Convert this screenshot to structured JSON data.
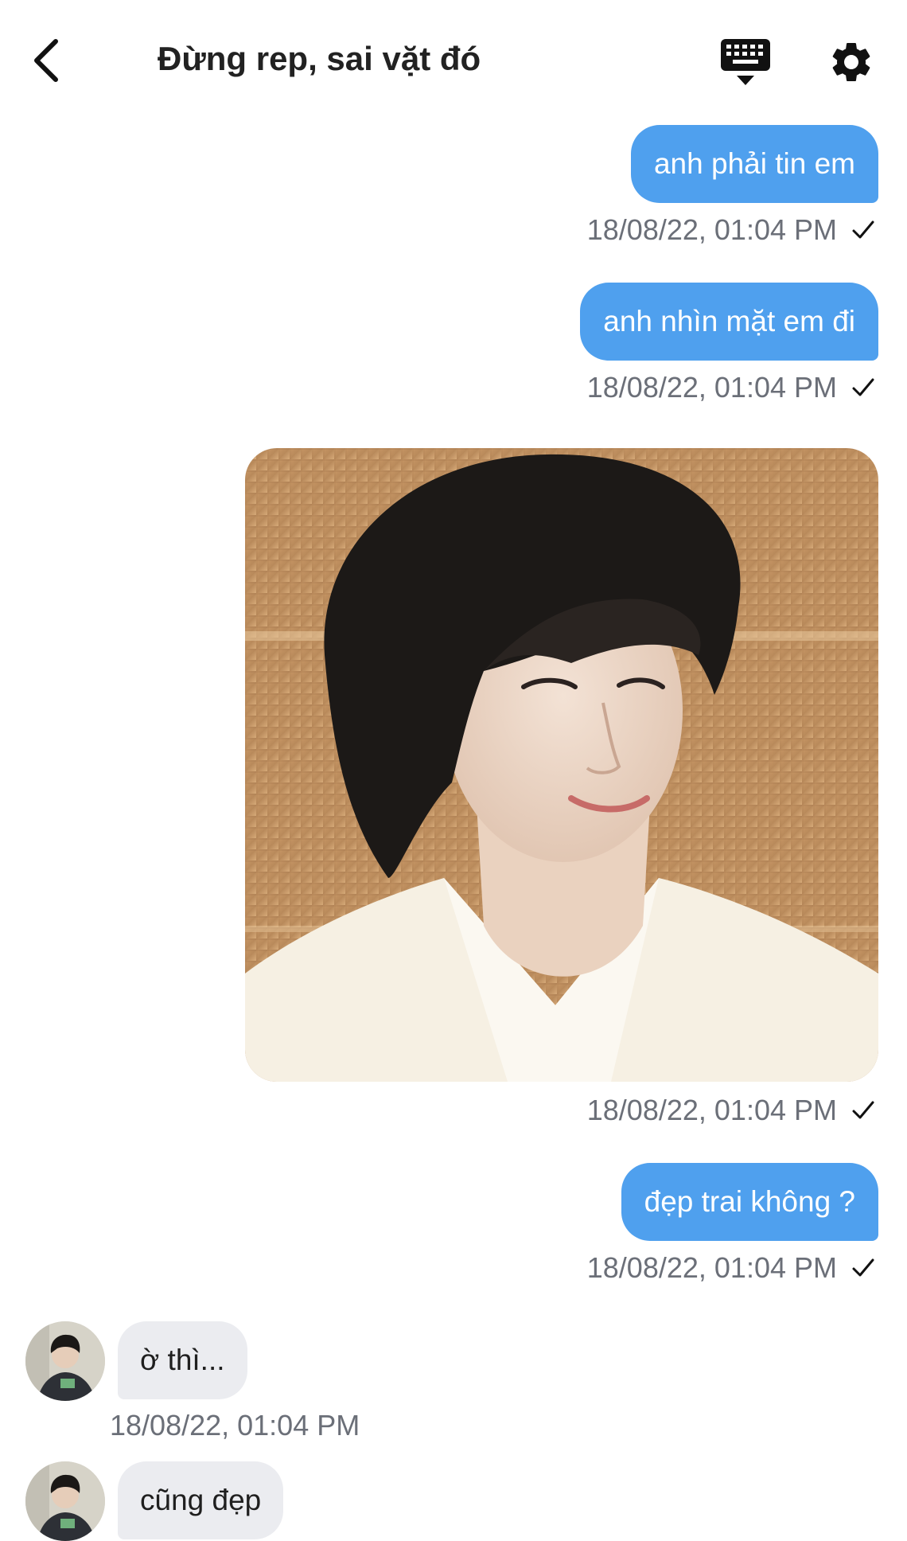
{
  "header": {
    "title": "Đừng rep, sai vặt đó",
    "back_icon": "chevron-left-icon",
    "keyboard_icon": "keyboard-icon",
    "settings_icon": "gear-icon"
  },
  "colors": {
    "outgoing_bubble": "#4fa0ee",
    "incoming_bubble": "#ebecf0",
    "timestamp": "#6b6f78"
  },
  "messages": [
    {
      "direction": "out",
      "text": "anh phải tin em",
      "time": "18/08/22, 01:04 PM",
      "status_icon": "check-icon"
    },
    {
      "direction": "out",
      "text": "anh nhìn mặt em đi",
      "time": "18/08/22, 01:04 PM",
      "status_icon": "check-icon"
    },
    {
      "direction": "out",
      "type": "image",
      "time": "18/08/22, 01:04 PM",
      "status_icon": "check-icon"
    },
    {
      "direction": "out",
      "text": "đẹp trai không ?",
      "time": "18/08/22, 01:04 PM",
      "status_icon": "check-icon"
    },
    {
      "direction": "in",
      "text": "ờ thì...",
      "time": "18/08/22, 01:04 PM"
    },
    {
      "direction": "in",
      "text": "cũng đẹp"
    }
  ]
}
